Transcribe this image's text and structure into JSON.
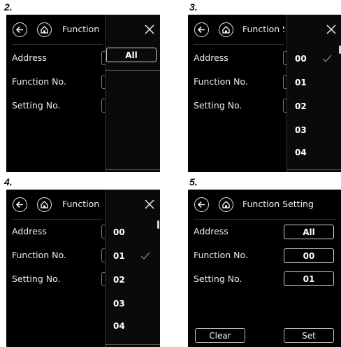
{
  "steps": {
    "s2": "2.",
    "s3": "3.",
    "s4": "4.",
    "s5": "5."
  },
  "screen": {
    "title_truncated": "Function S",
    "title_full": "Function Setting",
    "rows": {
      "address": "Address",
      "function_no": "Function No.",
      "setting_no": "Setting No."
    }
  },
  "panel2": {
    "options": [
      "All"
    ]
  },
  "panel3": {
    "options": [
      "00",
      "01",
      "02",
      "03",
      "04"
    ],
    "selected": "00"
  },
  "panel4": {
    "options": [
      "00",
      "01",
      "02",
      "03",
      "04"
    ],
    "selected": "01"
  },
  "screen5": {
    "address_value": "All",
    "function_value": "00",
    "setting_value": "01",
    "clear_label": "Clear",
    "set_label": "Set"
  },
  "icons": {
    "back": "back-arrow-icon",
    "home": "home-icon",
    "close": "close-icon",
    "check": "check-icon"
  },
  "colors": {
    "screen_bg": "#000000",
    "text": "#f2f2f2",
    "border": "#cfcfcf"
  }
}
